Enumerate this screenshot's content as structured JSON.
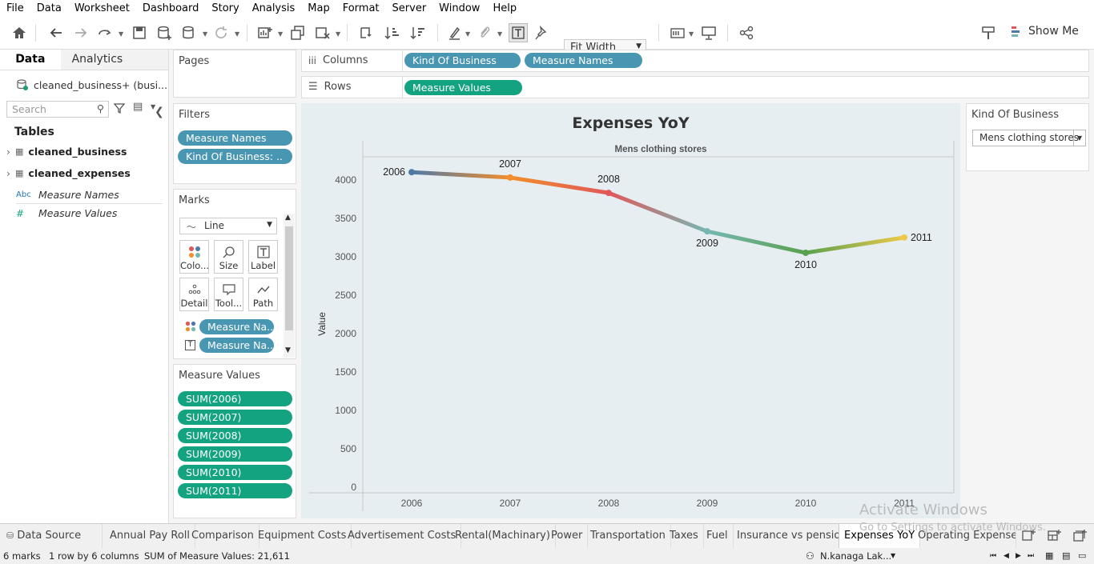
{
  "menu": [
    "File",
    "Data",
    "Worksheet",
    "Dashboard",
    "Story",
    "Analysis",
    "Map",
    "Format",
    "Server",
    "Window",
    "Help"
  ],
  "toolbar": {
    "fit_width": "Fit Width",
    "show_me": "Show Me"
  },
  "left_panel": {
    "tab_data": "Data",
    "tab_analytics": "Analytics",
    "datasource": "cleaned_business+ (busi...",
    "search_placeholder": "Search",
    "tables_heading": "Tables",
    "tables": [
      "cleaned_business",
      "cleaned_expenses"
    ],
    "fields": [
      {
        "type": "Abc",
        "name": "Measure Names"
      },
      {
        "type": "#",
        "name": "Measure Values"
      }
    ]
  },
  "pages_card": {
    "title": "Pages"
  },
  "filters_card": {
    "title": "Filters",
    "pills": [
      "Measure Names",
      "Kind Of Business:  .."
    ]
  },
  "marks_card": {
    "title": "Marks",
    "mark_type": "Line",
    "buttons": [
      "Colo...",
      "Size",
      "Label",
      "Detail",
      "Tool...",
      "Path"
    ],
    "pills": [
      "Measure Na..",
      "Measure Na.."
    ]
  },
  "measure_values_card": {
    "title": "Measure Values",
    "pills": [
      "SUM(2006)",
      "SUM(2007)",
      "SUM(2008)",
      "SUM(2009)",
      "SUM(2010)",
      "SUM(2011)"
    ]
  },
  "shelves": {
    "columns_label": "Columns",
    "columns_pills": [
      "Kind Of Business",
      "Measure Names"
    ],
    "rows_label": "Rows",
    "rows_pills": [
      "Measure Values"
    ]
  },
  "filter_panel": {
    "title": "Kind Of Business",
    "selected": "Mens clothing stores"
  },
  "chart_data": {
    "type": "line",
    "title": "Expenses YoY",
    "pane_header": "Mens clothing stores",
    "ylabel": "Value",
    "xlabel": "",
    "categories": [
      "2006",
      "2007",
      "2008",
      "2009",
      "2010",
      "2011"
    ],
    "values": [
      4100,
      4030,
      3830,
      3330,
      3050,
      3250
    ],
    "point_labels": [
      "2006",
      "2007",
      "2008",
      "2009",
      "2010",
      "2011"
    ],
    "point_colors": [
      "#4e79a7",
      "#f28e2b",
      "#e15759",
      "#76b7b2",
      "#59a14f",
      "#edc948"
    ],
    "ylim": [
      0,
      4300
    ],
    "yticks": [
      0,
      500,
      1000,
      1500,
      2000,
      2500,
      3000,
      3500,
      4000
    ],
    "grid": false
  },
  "sheet_tabs": {
    "datasource": "Data Source",
    "tabs": [
      "Annual Pay Roll",
      "Comparison",
      "Equipment Costs",
      "Advertisement Costs",
      "Rental(Machinary)",
      "Power",
      "Transportation",
      "Taxes",
      "Fuel",
      "Insurance vs pension",
      "Expenses YoY",
      "Operating Expenses"
    ],
    "active": "Expenses YoY"
  },
  "status": {
    "marks": "6 marks",
    "rows_cols": "1 row  by  6 columns",
    "sum": "SUM of Measure Values: 21,611",
    "user": "N.kanaga Lak..."
  },
  "watermark": {
    "line1": "Activate Windows",
    "line2": "Go to Settings to activate Windows."
  }
}
